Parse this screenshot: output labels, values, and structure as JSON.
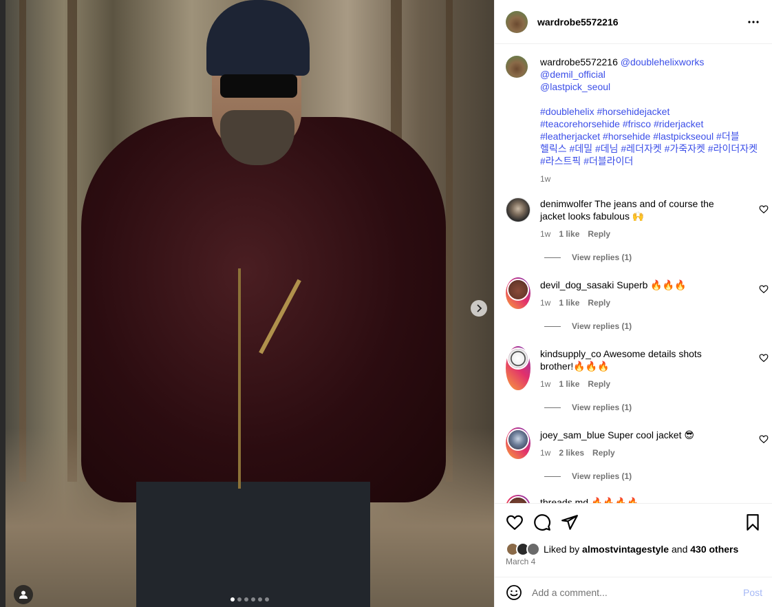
{
  "post": {
    "author": "wardrobe5572216",
    "carousel": {
      "slides": 6,
      "active_index": 0
    }
  },
  "caption": {
    "author": "wardrobe5572216",
    "mention_1": "@doublehelixworks",
    "mention_2": "@demil_official",
    "mention_3": "@lastpick_seoul",
    "hashtags_line_1": "#doublehelix #horsehidejacket",
    "hashtags_line_2": "#teacorehorsehide #frisco #riderjacket",
    "hashtags_line_3": "#leatherjacket #horsehide #lastpickseoul #더블",
    "hashtags_line_4": "헬릭스 #데밀 #데님 #레더자켓 #가죽자켓 #라이더자켓",
    "hashtags_line_5": "#라스트픽 #더블라이더",
    "time": "1w"
  },
  "comments": [
    {
      "user": "denimwolfer",
      "text_line_1": "The jeans and of course the",
      "text_line_2": "jacket looks fabulous 🙌",
      "time": "1w",
      "likes": "1 like",
      "reply": "Reply",
      "view_replies": "View replies (1)"
    },
    {
      "user": "devil_dog_sasaki",
      "text_line_1": "Superb 🔥🔥🔥",
      "time": "1w",
      "likes": "1 like",
      "reply": "Reply",
      "view_replies": "View replies (1)"
    },
    {
      "user": "kindsupply_co",
      "text_line_1": "Awesome details shots",
      "text_line_2": "brother!🔥🔥🔥",
      "time": "1w",
      "likes": "1 like",
      "reply": "Reply",
      "view_replies": "View replies (1)"
    },
    {
      "user": "joey_sam_blue",
      "text_line_1": "Super cool jacket 😎",
      "time": "1w",
      "likes": "2 likes",
      "reply": "Reply",
      "view_replies": "View replies (1)"
    },
    {
      "user": "threads.md",
      "text_line_1": "🔥🔥🔥🔥"
    }
  ],
  "engagement": {
    "liked_by_prefix": "Liked by",
    "liked_by_user": "almostvintagestyle",
    "and_word": "and",
    "others": "430 others",
    "date": "March 4"
  },
  "composer": {
    "placeholder": "Add a comment...",
    "post_label": "Post"
  },
  "icons": {
    "heart": "heart-icon",
    "comment": "comment-icon",
    "share": "share-icon",
    "save": "bookmark-icon",
    "emoji": "emoji-icon",
    "more": "more-icon",
    "next": "chevron-right-icon",
    "user_tag": "user-tag-icon"
  },
  "colors": {
    "link": "#3b4ee8",
    "muted": "#737373",
    "post_button": "#a5b8f6",
    "divider": "#efefef"
  }
}
